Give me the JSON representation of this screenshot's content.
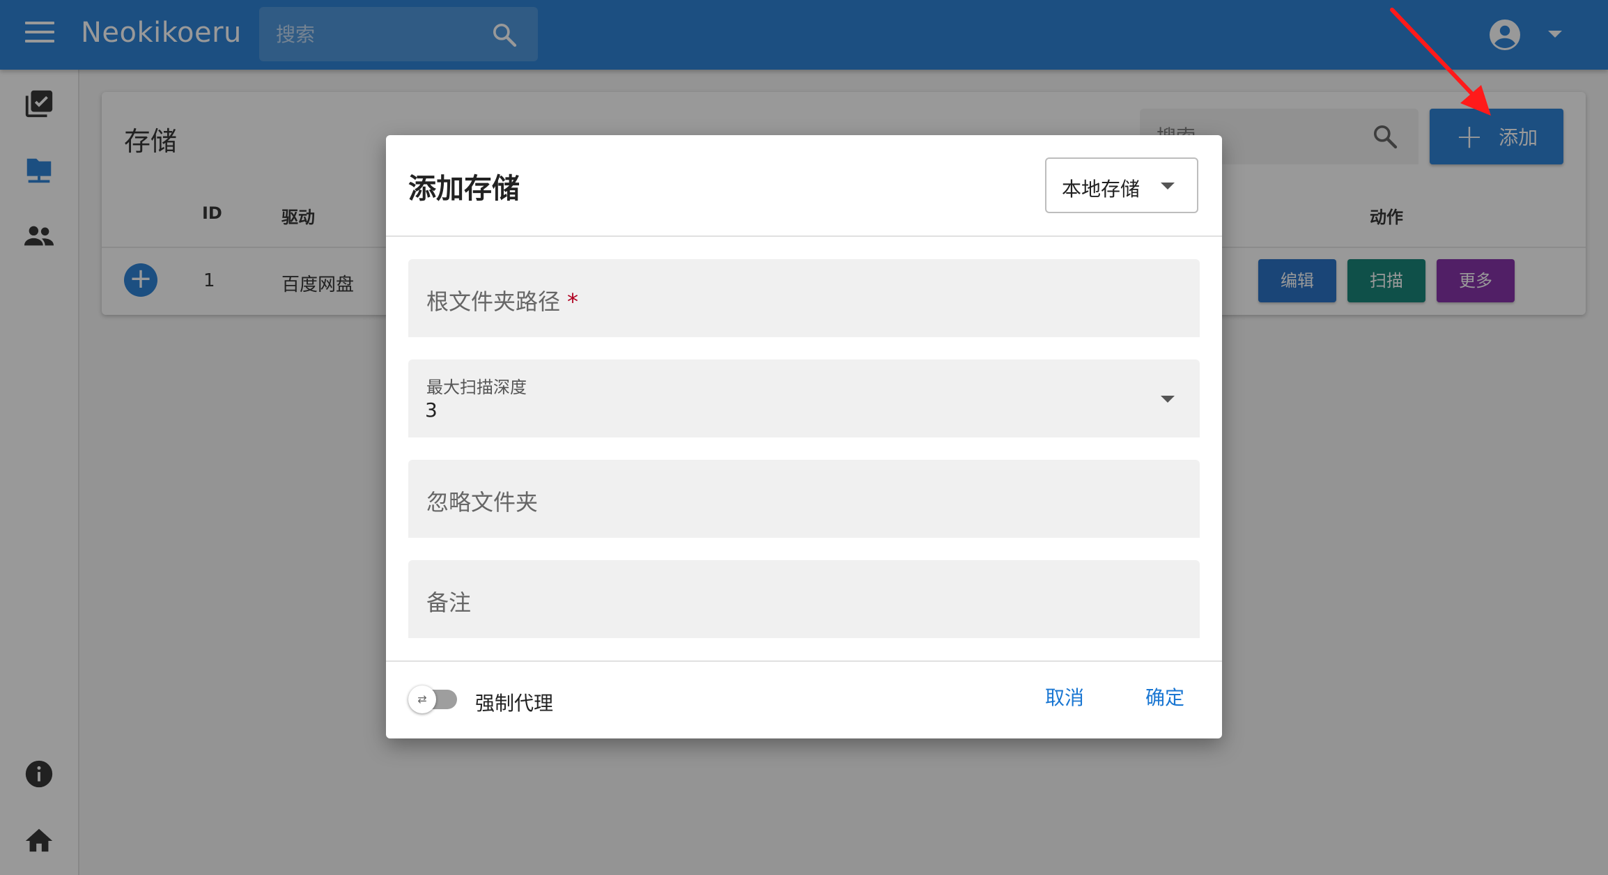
{
  "app": {
    "title": "Neokikoeru"
  },
  "top_search": {
    "placeholder": "搜索"
  },
  "page": {
    "title": "存储",
    "search_placeholder": "搜索",
    "add_label": "添加",
    "columns": [
      "ID",
      "驱动",
      "动作"
    ],
    "rows": [
      {
        "id": "1",
        "driver": "百度网盘",
        "actions": [
          "编辑",
          "扫描",
          "更多"
        ]
      }
    ],
    "action_colors": [
      "#1565c0",
      "#00796b",
      "#7b1fa2"
    ]
  },
  "dialog": {
    "title": "添加存储",
    "storage_type": "本地存储",
    "fields": {
      "root_path": {
        "label": "根文件夹路径",
        "required_mark": "*"
      },
      "max_depth": {
        "label": "最大扫描深度",
        "value": "3"
      },
      "ignore_folders": {
        "label": "忽略文件夹"
      },
      "note": {
        "label": "备注"
      }
    },
    "force_proxy_label": "强制代理",
    "force_proxy_on": false,
    "cancel_label": "取消",
    "confirm_label": "确定"
  },
  "colors": {
    "primary": "#1976d2",
    "annotation_arrow": "#ff1a1a"
  }
}
